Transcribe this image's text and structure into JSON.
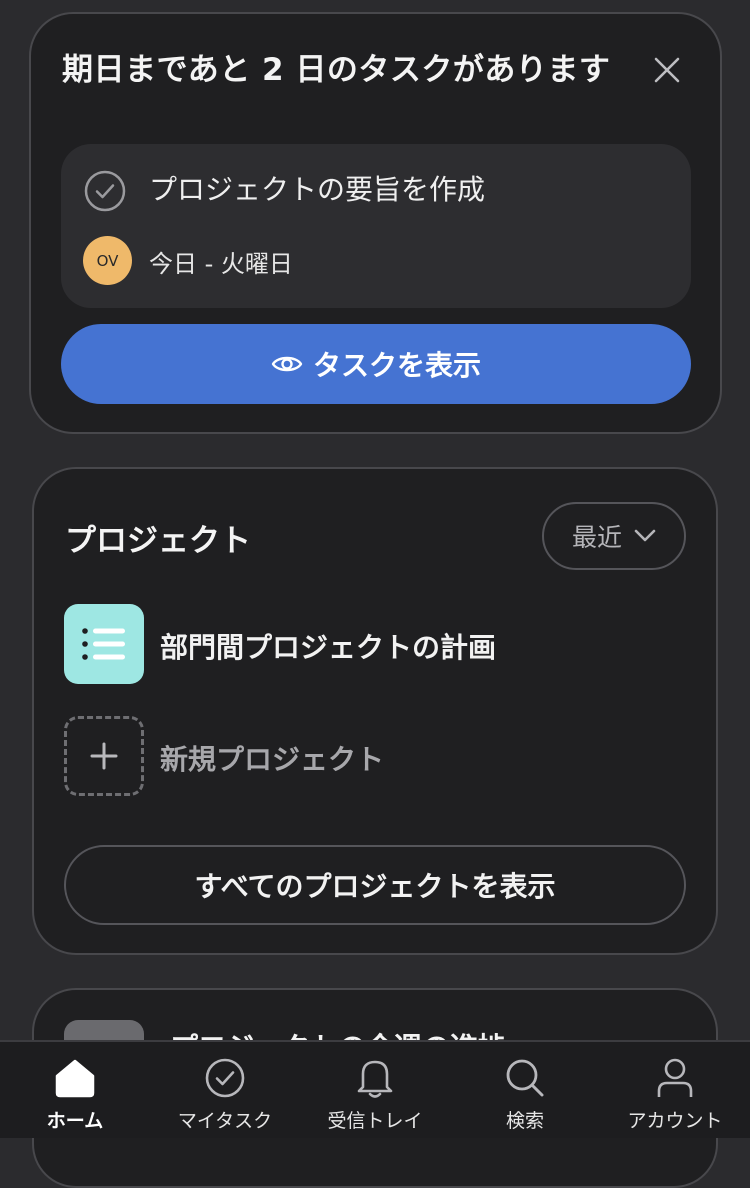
{
  "due_card": {
    "title": "期日まであと 2 日のタスクがあります",
    "task": {
      "name": "プロジェクトの要旨を作成",
      "assignee_initials": "OV",
      "due": "今日 - 火曜日"
    },
    "view_button_label": "タスクを表示"
  },
  "projects": {
    "title": "プロジェクト",
    "sort_label": "最近",
    "items": [
      {
        "name": "部門間プロジェクトの計画",
        "icon": "list-icon",
        "color": "#9ee7e3"
      }
    ],
    "new_project_label": "新規プロジェクト",
    "view_all_label": "すべてのプロジェクトを表示"
  },
  "next_card": {
    "title": "プロジェクトの今週の進捗"
  },
  "tabbar": {
    "items": [
      {
        "label": "ホーム",
        "icon": "home-icon",
        "active": true
      },
      {
        "label": "マイタスク",
        "icon": "check-circle-icon",
        "active": false
      },
      {
        "label": "受信トレイ",
        "icon": "bell-icon",
        "active": false
      },
      {
        "label": "検索",
        "icon": "search-icon",
        "active": false
      },
      {
        "label": "アカウント",
        "icon": "person-icon",
        "active": false
      }
    ]
  },
  "colors": {
    "accent": "#4573d2",
    "avatar": "#efb96a",
    "background": "#2b2b2e",
    "card": "#1f1f21"
  }
}
